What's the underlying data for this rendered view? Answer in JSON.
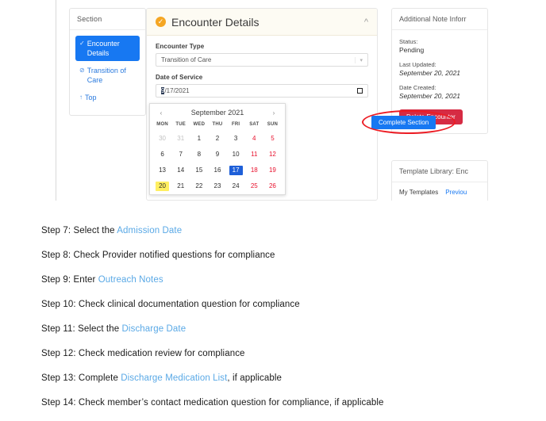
{
  "app": {
    "section_card": {
      "header": "Section",
      "items": [
        {
          "icon": "check-circle-icon",
          "glyph": "✓",
          "label": "Encounter Details",
          "active": true
        },
        {
          "icon": "check-circle-icon",
          "glyph": "⊘",
          "label": "Transition of Care",
          "active": false
        },
        {
          "icon": "arrow-up-icon",
          "glyph": "↑",
          "label": "Top",
          "active": false
        }
      ]
    },
    "encounter": {
      "title": "Encounter Details",
      "status_icon": "check-circle-icon",
      "collapse_icon": "chevron-up-icon",
      "encounter_type_label": "Encounter Type",
      "encounter_type_value": "Transition of Care",
      "date_label": "Date of Service",
      "date_value_selected": "9",
      "date_value_rest": "/17/2021",
      "calendar_icon": "calendar-icon"
    },
    "calendar": {
      "prev_icon": "chevron-left-icon",
      "next_icon": "chevron-right-icon",
      "month": "September 2021",
      "weekdays": [
        "MON",
        "TUE",
        "WED",
        "THU",
        "FRI",
        "SAT",
        "SUN"
      ],
      "weeks": [
        [
          {
            "d": "30",
            "state": "mute"
          },
          {
            "d": "31",
            "state": "mute"
          },
          {
            "d": "1",
            "state": ""
          },
          {
            "d": "2",
            "state": ""
          },
          {
            "d": "3",
            "state": ""
          },
          {
            "d": "4",
            "state": "we"
          },
          {
            "d": "5",
            "state": "we"
          }
        ],
        [
          {
            "d": "6",
            "state": ""
          },
          {
            "d": "7",
            "state": ""
          },
          {
            "d": "8",
            "state": ""
          },
          {
            "d": "9",
            "state": ""
          },
          {
            "d": "10",
            "state": ""
          },
          {
            "d": "11",
            "state": "we"
          },
          {
            "d": "12",
            "state": "we"
          }
        ],
        [
          {
            "d": "13",
            "state": ""
          },
          {
            "d": "14",
            "state": ""
          },
          {
            "d": "15",
            "state": ""
          },
          {
            "d": "16",
            "state": ""
          },
          {
            "d": "17",
            "state": "sel"
          },
          {
            "d": "18",
            "state": "we"
          },
          {
            "d": "19",
            "state": "we"
          }
        ],
        [
          {
            "d": "20",
            "state": "today"
          },
          {
            "d": "21",
            "state": ""
          },
          {
            "d": "22",
            "state": ""
          },
          {
            "d": "23",
            "state": ""
          },
          {
            "d": "24",
            "state": ""
          },
          {
            "d": "25",
            "state": "we"
          },
          {
            "d": "26",
            "state": "we"
          }
        ]
      ]
    },
    "complete_button": "Complete Section",
    "note_panel": {
      "header": "Additional Note Inforr",
      "status_label": "Status:",
      "status_value": "Pending",
      "last_updated_label": "Last Updated:",
      "last_updated_value": "September 20, 2021",
      "date_created_label": "Date Created:",
      "date_created_value": "September 20, 2021",
      "delete_button": "Delete Encounter"
    },
    "template_panel": {
      "header": "Template Library: Enc",
      "tab_my_templates": "My Templates",
      "tab_previous": "Previou"
    },
    "accent_blue": "#1778f2",
    "annotation_red": "#ec1c24",
    "today_yellow": "#ffef61",
    "delete_red": "#d62b43"
  },
  "steps": [
    {
      "prefix": "Step 7: Select the ",
      "link": "Admission Date",
      "suffix": ""
    },
    {
      "prefix": "Step 8: Check Provider notified questions for compliance",
      "link": "",
      "suffix": ""
    },
    {
      "prefix": "Step 9: Enter ",
      "link": "Outreach Notes",
      "suffix": ""
    },
    {
      "prefix": "Step 10: Check clinical documentation question for compliance",
      "link": "",
      "suffix": ""
    },
    {
      "prefix": "Step 11: Select the ",
      "link": "Discharge Date",
      "suffix": ""
    },
    {
      "prefix": "Step 12: Check medication review for compliance",
      "link": "",
      "suffix": ""
    },
    {
      "prefix": "Step 13: Complete ",
      "link": "Discharge Medication List",
      "suffix": ", if applicable"
    },
    {
      "prefix": "Step 14: Check member’s contact medication question for compliance, if applicable",
      "link": "",
      "suffix": ""
    }
  ]
}
